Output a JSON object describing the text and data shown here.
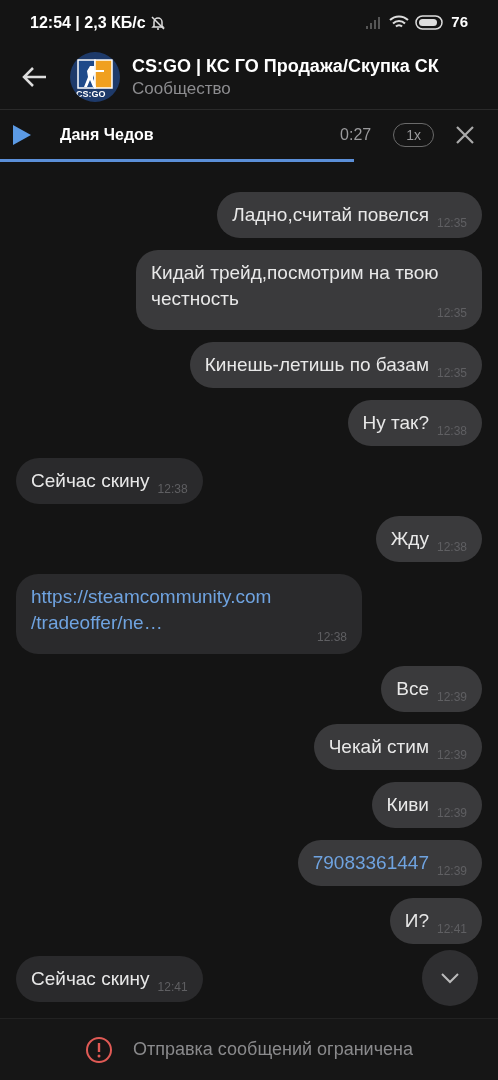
{
  "status_bar": {
    "time": "12:54 | 2,3 КБ/с",
    "battery": "76"
  },
  "header": {
    "title": "CS:GO | КС ГО Продажа/Скупка СК",
    "subtitle": "Сообщество",
    "avatar_label": "CS:GO"
  },
  "player": {
    "name": "Даня Чедов",
    "duration": "0:27",
    "speed": "1x",
    "level": 0.71
  },
  "messages": [
    {
      "outgoing": true,
      "kind": "text",
      "text": "Ладно,считай повелся",
      "time": "12:35"
    },
    {
      "outgoing": true,
      "kind": "text",
      "text": "Кидай трейд,посмотрим на твою честность",
      "time": "12:35"
    },
    {
      "outgoing": true,
      "kind": "text",
      "text": "Кинешь-летишь по базам",
      "time": "12:35"
    },
    {
      "outgoing": true,
      "kind": "text",
      "text": "Ну так?",
      "time": "12:38"
    },
    {
      "outgoing": false,
      "kind": "text",
      "text": "Сейчас скину",
      "time": "12:38"
    },
    {
      "outgoing": true,
      "kind": "text",
      "text": "Жду",
      "time": "12:38"
    },
    {
      "outgoing": false,
      "kind": "link",
      "text": "https://steamcommunity.com /tradeoffer/ne…",
      "time": "12:38"
    },
    {
      "outgoing": true,
      "kind": "text",
      "text": "Все",
      "time": "12:39"
    },
    {
      "outgoing": true,
      "kind": "text",
      "text": "Чекай стим",
      "time": "12:39"
    },
    {
      "outgoing": true,
      "kind": "text",
      "text": "Киви",
      "time": "12:39"
    },
    {
      "outgoing": true,
      "kind": "link",
      "text": "79083361447",
      "time": "12:39"
    },
    {
      "outgoing": true,
      "kind": "text",
      "text": "И?",
      "time": "12:41"
    },
    {
      "outgoing": false,
      "kind": "text",
      "text": "Сейчас скину",
      "time": "12:41"
    }
  ],
  "notice": "Отправка сообщений ограничена"
}
